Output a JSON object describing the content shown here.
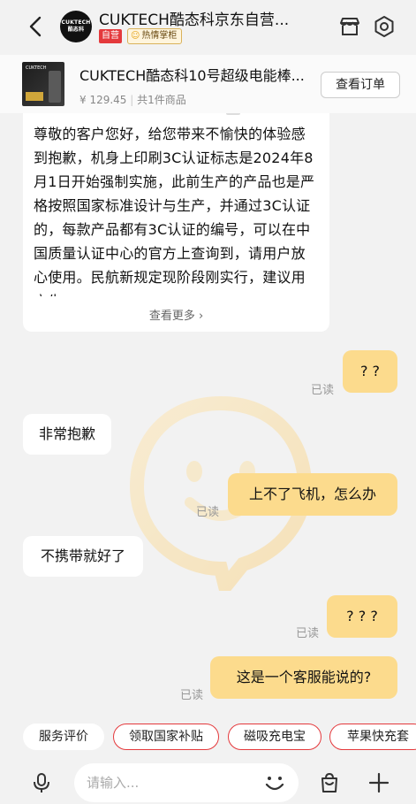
{
  "header": {
    "shop_name": "CUKTECH酷态科京东自营...",
    "avatar_text": "CUKTECH 酷态科",
    "self_badge": "自营",
    "hot_badge": "热情掌柜"
  },
  "order": {
    "thumb_text": "CUKTECH",
    "product_title": "CUKTECH酷态科10号超级电能棒...",
    "price": "¥ 129.45",
    "quantity": "共1件商品",
    "view_order_label": "查看订单"
  },
  "messages": {
    "long": {
      "text": "尊敬的客户您好，给您带来不愉快的体验感到抱歉，机身上印刷3C认证标志是2024年8月1日开始强制实施，此前生产的产品也是严格按照国家标准设计与生产，并通过3C认证的，每款产品都有3C认证的编号，可以在中国质量认证中心的官方上查询到，请用户放心使用。民航新规定现阶段刚实行，建议用户先",
      "more": "查看更多 ›"
    },
    "m1": {
      "text": "? ?",
      "status": "已读"
    },
    "m2": {
      "text": "非常抱歉"
    },
    "m3": {
      "text": "上不了飞机，怎么办",
      "status": "已读"
    },
    "m4": {
      "text": "不携带就好了"
    },
    "m5": {
      "text": "? ? ?",
      "status": "已读"
    },
    "m6": {
      "text": "这是一个客服能说的?",
      "status": "已读"
    }
  },
  "quick_replies": [
    "服务评价",
    "领取国家补贴",
    "磁吸充电宝",
    "苹果快充套"
  ],
  "input": {
    "placeholder": "请输入..."
  },
  "colors": {
    "accent_red": "#e4393c",
    "bubble_yellow": "#fcdb8d"
  }
}
